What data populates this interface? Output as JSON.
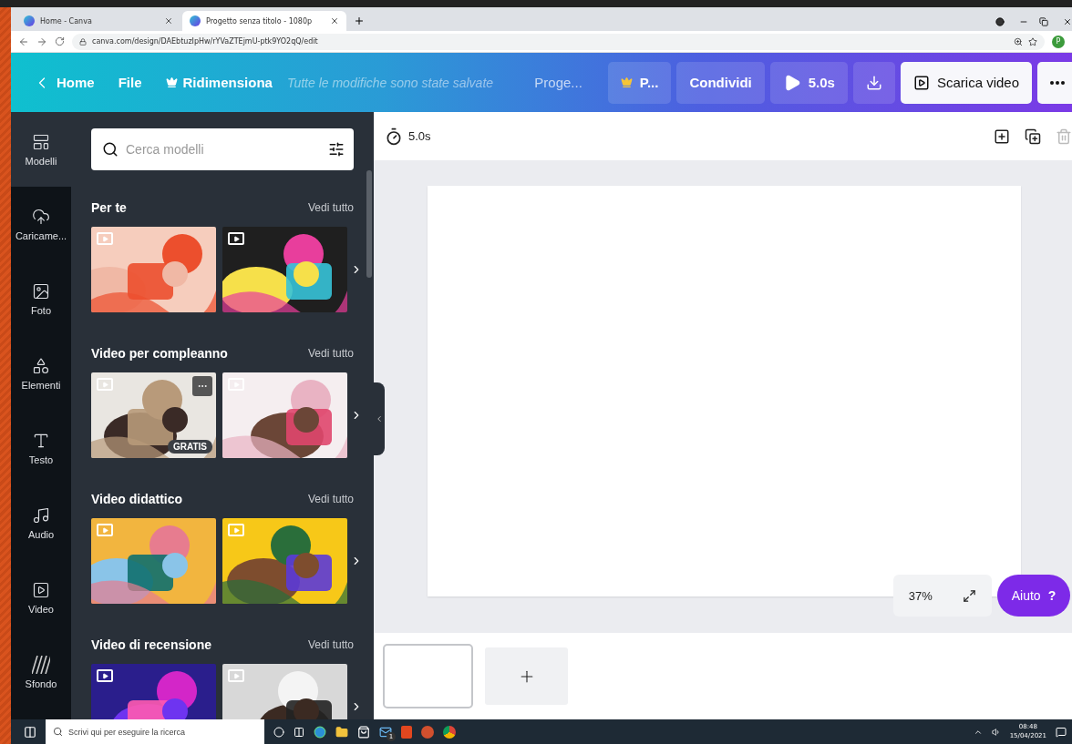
{
  "browser": {
    "tabs": [
      {
        "title": "Home - Canva",
        "selected": false
      },
      {
        "title": "Progetto senza titolo - 1080p",
        "selected": true
      }
    ],
    "url": "canva.com/design/DAEbtuzIpHw/rYVaZTEjmU-ptk9YO2qQ/edit",
    "profile": "P"
  },
  "toolbar": {
    "home": "Home",
    "file": "File",
    "resize": "Ridimensiona",
    "status": "Tutte le modifiche sono state salvate",
    "project": "Proge...",
    "pro": "P...",
    "share": "Condividi",
    "play": "5.0s",
    "download": "Scarica video"
  },
  "rail": [
    {
      "label": "Modelli",
      "selected": true
    },
    {
      "label": "Caricame...",
      "selected": false
    },
    {
      "label": "Foto",
      "selected": false
    },
    {
      "label": "Elementi",
      "selected": false
    },
    {
      "label": "Testo",
      "selected": false
    },
    {
      "label": "Audio",
      "selected": false
    },
    {
      "label": "Video",
      "selected": false
    },
    {
      "label": "Sfondo",
      "selected": false
    }
  ],
  "panel": {
    "search_placeholder": "Cerca modelli",
    "sections": [
      {
        "title": "Per te",
        "link": "Vedi tutto",
        "thumbnails": [
          {
            "kind": "picture"
          },
          {
            "kind": "picture"
          }
        ]
      },
      {
        "title": "Video per compleanno",
        "link": "Vedi tutto",
        "thumbnails": [
          {
            "kind": "picture",
            "badge": "GRATIS",
            "menu": true
          },
          {
            "kind": "picture"
          }
        ]
      },
      {
        "title": "Video didattico",
        "link": "Vedi tutto",
        "thumbnails": [
          {
            "kind": "picture"
          },
          {
            "kind": "picture"
          }
        ]
      },
      {
        "title": "Video di recensione",
        "link": "Vedi tutto",
        "thumbnails": [
          {
            "kind": "picture"
          },
          {
            "kind": "picture"
          }
        ]
      }
    ]
  },
  "canvas": {
    "duration": "5.0s",
    "zoom": "37%",
    "help": "Aiuto",
    "help_mark": "?"
  },
  "taskbar": {
    "search_placeholder": "Scrivi qui per eseguire la ricerca",
    "mail_count": "1",
    "time": "08:48",
    "date": "15/04/2021"
  }
}
